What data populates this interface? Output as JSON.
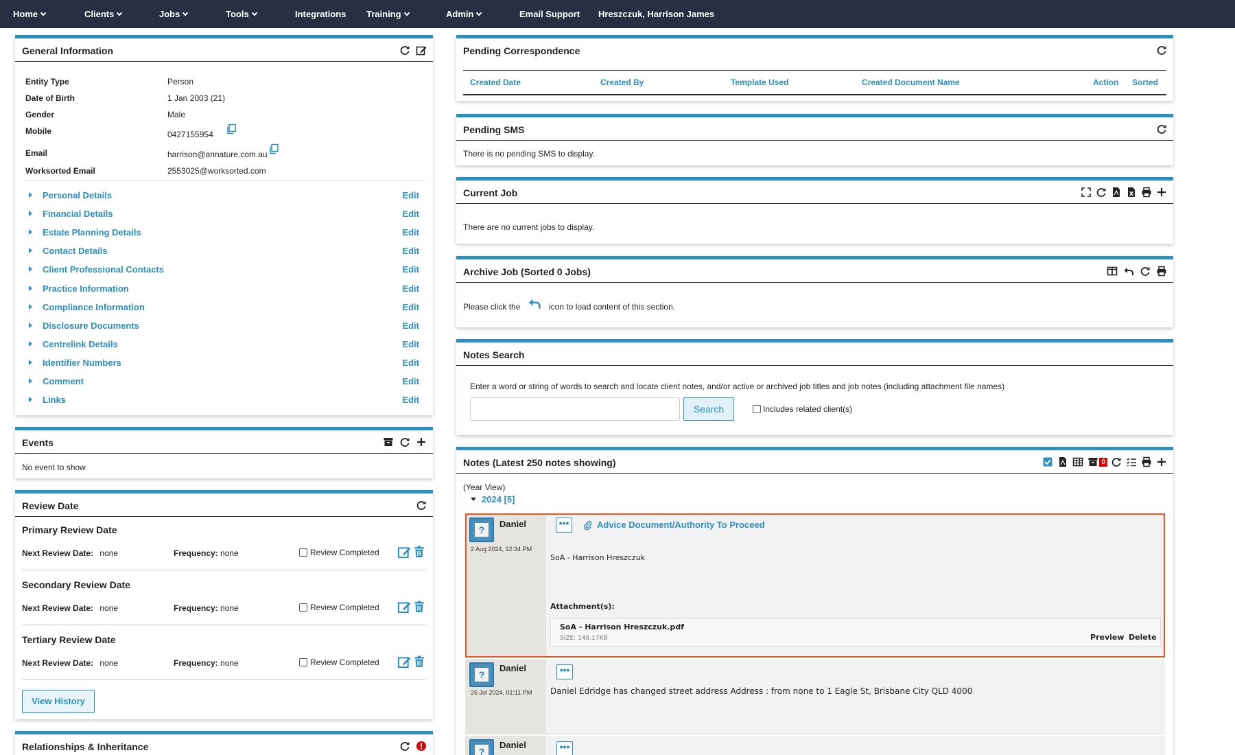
{
  "nav": {
    "home": "Home",
    "clients": "Clients",
    "jobs": "Jobs",
    "tools": "Tools",
    "integrations": "Integrations",
    "training": "Training",
    "admin": "Admin",
    "email_support": "Email Support",
    "client_name": "Hreszczuk, Harrison James"
  },
  "general": {
    "title": "General Information",
    "fields": [
      {
        "label": "Entity Type",
        "value": "Person"
      },
      {
        "label": "Date of Birth",
        "value": "1 Jan 2003 (21)"
      },
      {
        "label": "Gender",
        "value": "Male"
      },
      {
        "label": "Mobile",
        "value": "0427155954"
      },
      {
        "label": "Email",
        "value": "harrison@annature.com.au"
      },
      {
        "label": "Worksorted Email",
        "value": "2553025@worksorted.com"
      }
    ],
    "sections": [
      "Personal Details",
      "Financial Details",
      "Estate Planning Details",
      "Contact Details",
      "Client Professional Contacts",
      "Practice Information",
      "Compliance Information",
      "Disclosure Documents",
      "Centrelink Details",
      "Identifier Numbers",
      "Comment",
      "Links"
    ],
    "edit_label": "Edit"
  },
  "events": {
    "title": "Events",
    "empty": "No event to show"
  },
  "review": {
    "title": "Review Date",
    "blocks": [
      {
        "title": "Primary Review Date"
      },
      {
        "title": "Secondary Review Date"
      },
      {
        "title": "Tertiary Review Date"
      }
    ],
    "next_label": "Next Review Date:",
    "next_value": "none",
    "freq_label": "Frequency:",
    "freq_value": "none",
    "completed_label": "Review Completed",
    "history_button": "View History"
  },
  "relationships": {
    "title": "Relationships & Inheritance"
  },
  "pending_correspondence": {
    "title": "Pending Correspondence",
    "columns": [
      "Created Date",
      "Created By",
      "Template Used",
      "Created Document Name",
      "Action",
      "Sorted"
    ]
  },
  "pending_sms": {
    "title": "Pending SMS",
    "empty": "There is no pending SMS to display."
  },
  "current_job": {
    "title": "Current Job",
    "empty": "There are no current jobs to display."
  },
  "archive_job": {
    "title": "Archive Job (Sorted 0 Jobs)",
    "msg_before": "Please click the",
    "msg_after": "icon to load content of this section."
  },
  "notes_search": {
    "title": "Notes Search",
    "instructions": "Enter a word or string of words to search and locate client notes, and/or active or archived job titles and job notes (including attachment file names)",
    "search_button": "Search",
    "related_label": "Includes related client(s)",
    "input_value": ""
  },
  "notes": {
    "title": "Notes (Latest 250 notes showing)",
    "badge_count": "0",
    "view_label": "(Year View)",
    "year_label": "2024 [5]",
    "items": [
      {
        "author": "Daniel",
        "date": "2 Aug 2024, 12:34 PM",
        "heading": "Advice Document/Authority To Proceed",
        "body": "SoA - Harrison Hreszczuk",
        "attachments_label": "Attachment(s):",
        "attachment_name": "SoA - Harrison Hreszczuk.pdf",
        "attachment_size": "SIZE: 148.17KB",
        "preview": "Preview",
        "delete": "Delete"
      },
      {
        "author": "Daniel",
        "date": "26 Jul 2024, 01:11 PM",
        "body": "Daniel Edridge has changed street address Address : from none to 1 Eagle St, Brisbane City QLD 4000"
      },
      {
        "author": "Daniel"
      }
    ]
  },
  "colors": {
    "accent": "#2a8fc1",
    "nav_bg": "#273043",
    "highlight_border": "#e8572a"
  }
}
